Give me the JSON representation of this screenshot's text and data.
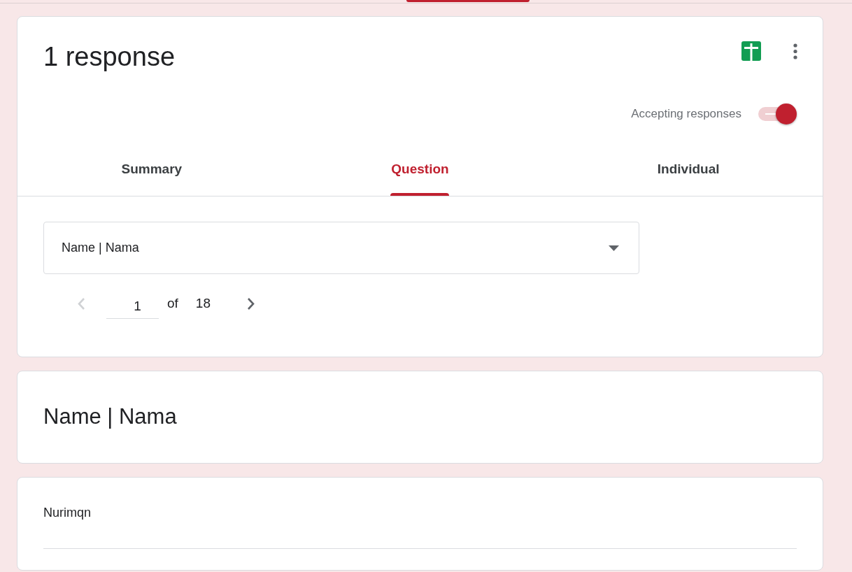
{
  "summary_card": {
    "title": "1 response",
    "accepting_responses": {
      "label": "Accepting responses",
      "on": true
    }
  },
  "tabs": [
    {
      "label": "Summary",
      "selected": false
    },
    {
      "label": "Question",
      "selected": true
    },
    {
      "label": "Individual",
      "selected": false
    }
  ],
  "question_picker": {
    "value": "Name | Nama",
    "page": "1",
    "of_label": "of",
    "total": "18",
    "prev_disabled": true,
    "next_disabled": false
  },
  "question": {
    "title": "Name | Nama"
  },
  "answers": [
    "Nurimqn"
  ]
}
